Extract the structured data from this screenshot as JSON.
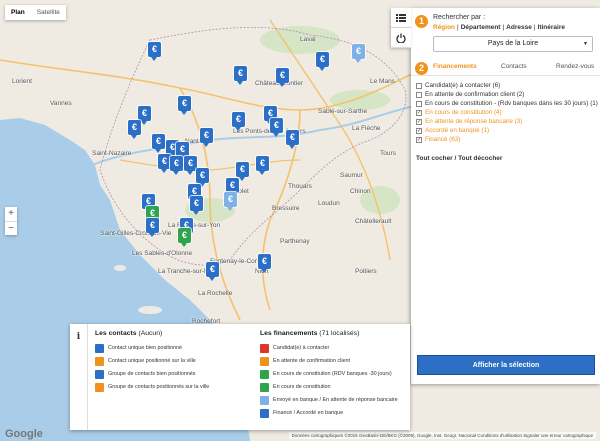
{
  "map": {
    "map_type_tabs": [
      "Plan",
      "Satellite"
    ],
    "zoom_in": "+",
    "zoom_out": "−",
    "google_logo": "Google",
    "attribution": "Données cartographiques ©2015 GeoBasis-DE/BKG (©2009), Google, Inst. Geogr. Nacional   Conditions d'utilisation   Signaler une erreur cartographique",
    "cities": [
      "Laval",
      "Le Mans",
      "Château-Gontier",
      "Sablé-sur-Sarthe",
      "La Flèche",
      "Angers",
      "Saumur",
      "Saint-Nazaire",
      "Nantes",
      "Cholet",
      "Les Ponts-de-Cé",
      "Bressuire",
      "Saint-Gilles-Croix-de-Vie",
      "La Roche-sur-Yon",
      "Les Sables-d'Olonne",
      "Niort",
      "La Rochelle",
      "Poitiers",
      "Tours",
      "Vannes",
      "Lorient",
      "Châtellerault",
      "Parthenay",
      "Thouars",
      "Rochefort",
      "Loudun",
      "Chinon",
      "La Tranche-sur-Mer",
      "Fontenay-le-Comte"
    ],
    "marker_symbol": "€"
  },
  "panel": {
    "list_icon": "list-icon",
    "power_icon": "power-icon",
    "step1": "1",
    "search_label": "Rechercher par :",
    "search_modes": [
      "Région",
      "Département",
      "Adresse",
      "Itinéraire"
    ],
    "region_value": "Pays de la Loire",
    "step2": "2",
    "tabs": [
      "Financements",
      "Contacts",
      "Rendez-vous"
    ],
    "filters": [
      {
        "label": "Candidat(e) à contacter (6)",
        "checked": false
      },
      {
        "label": "En attente de confirmation client (2)",
        "checked": false
      },
      {
        "label": "En cours de constitution - (Rdv banques dans les 30 jours) (1)",
        "checked": false
      },
      {
        "label": "En cours de constitution (4)",
        "checked": true
      },
      {
        "label": "En attente de réponse bancaire (3)",
        "checked": true
      },
      {
        "label": "Accordé en banque (1)",
        "checked": true
      },
      {
        "label": "Financé (63)",
        "checked": true
      }
    ],
    "check_all": "Tout cocher",
    "uncheck_all": "Tout décocher",
    "slash": " / ",
    "show_button": "Afficher la sélection"
  },
  "legend": {
    "info": "i",
    "contacts_title": "Les contacts",
    "contacts_count": " (Aucun)",
    "contacts": [
      {
        "label": "Contact unique bien positionné",
        "color": "#2b6fc6"
      },
      {
        "label": "Contact unique positionné sur la ville",
        "color": "#f0931d"
      },
      {
        "label": "Groupe de contacts bien positionnés",
        "color": "#2b6fc6"
      },
      {
        "label": "Groupe de contacts positionnés sur la ville",
        "color": "#f0931d"
      }
    ],
    "fin_title": "Les financements",
    "fin_count": " (71 localisés)",
    "financements": [
      {
        "label": "Candidat(e) à contacter",
        "color": "#d9382b"
      },
      {
        "label": "En attente de confirmation client",
        "color": "#f0931d"
      },
      {
        "label": "En cours de constitution (RDV banques -30 jours)",
        "color": "#2ea44f"
      },
      {
        "label": "En cours de constitution",
        "color": "#2ea44f"
      },
      {
        "label": "Envoyé en banque / En attente de réponse bancaire",
        "color": "#7fb0e8"
      },
      {
        "label": "Financé / Accordé en banque",
        "color": "#2b6fc6"
      }
    ]
  },
  "colors": {
    "accent": "#f0931d",
    "button": "#2d6fc4",
    "marker_blue": "#2b6fc6",
    "marker_green": "#2ea44f"
  }
}
